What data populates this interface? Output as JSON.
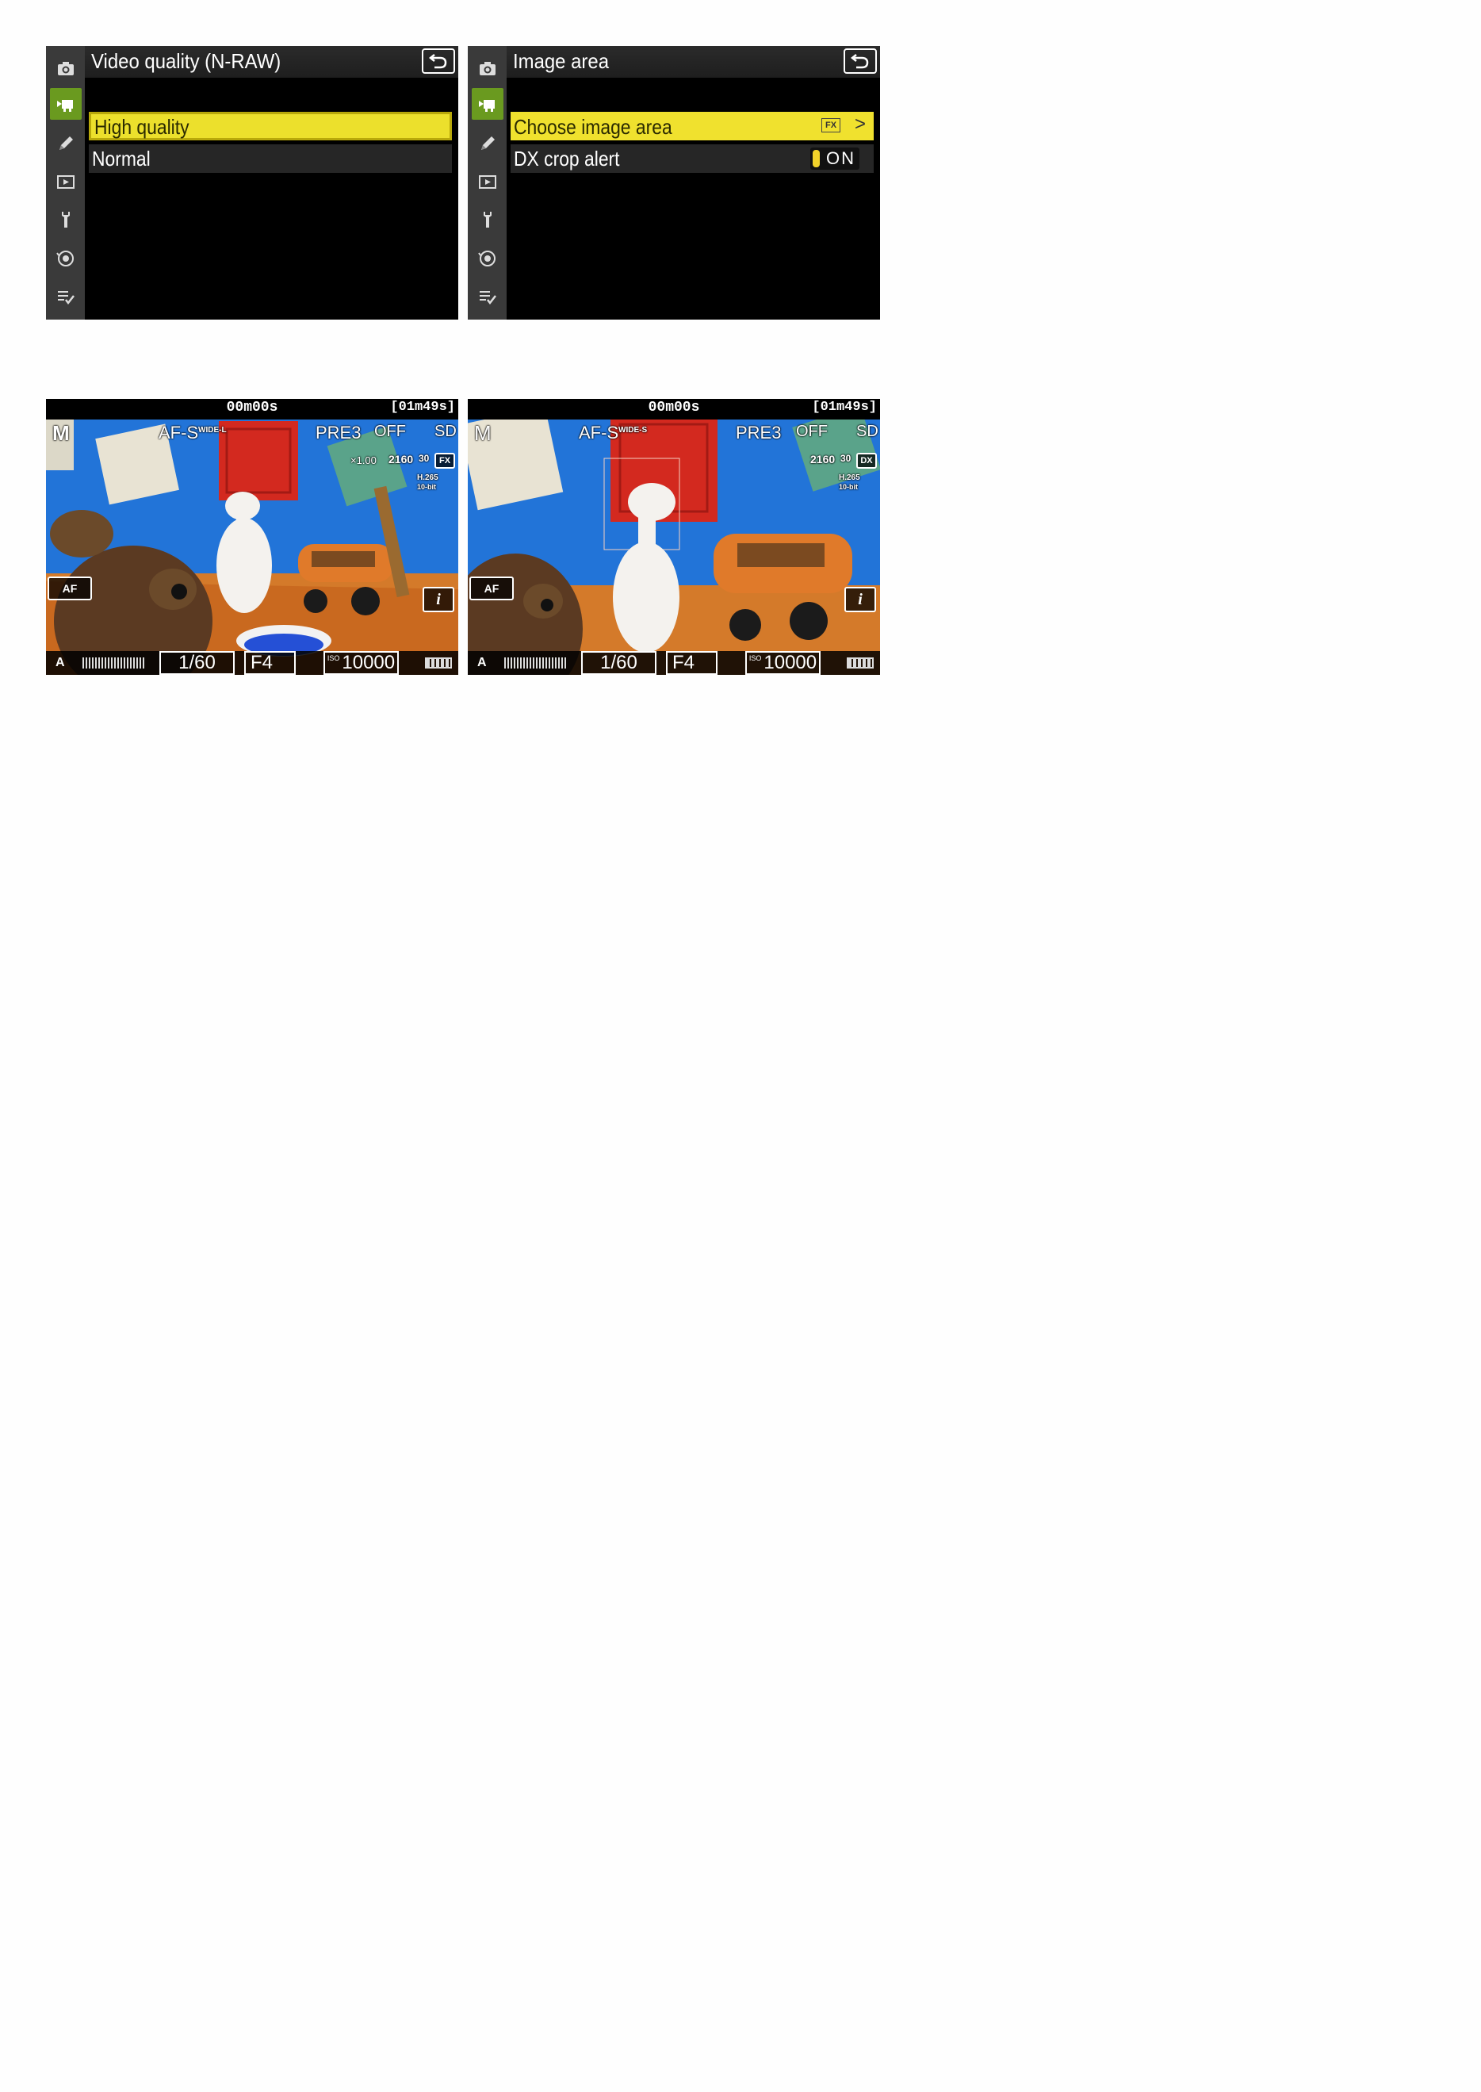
{
  "screens": {
    "video_quality": {
      "title": "Video quality (N-RAW)",
      "options": [
        "High quality",
        "Normal"
      ],
      "selected_index": 0
    },
    "image_area": {
      "title": "Image area",
      "options": [
        {
          "label": "Choose image area",
          "value_badge": "FX",
          "chevron": ">"
        },
        {
          "label": "DX crop alert",
          "toggle": "ON"
        }
      ],
      "selected_index": 0
    }
  },
  "sidebar_icons": [
    "camera-icon",
    "movie-icon",
    "pencil-icon",
    "playback-icon",
    "wrench-icon",
    "network-icon",
    "my-menu-icon"
  ],
  "liveview_fx": {
    "timer": "00m00s",
    "remaining": "[01m49s]",
    "mode": "M",
    "focus_mode": "AF-S",
    "af_area": "WIDE-L",
    "picture_control": "PRE3",
    "vr": "OFF",
    "card": "SD",
    "zoom": "×1.00",
    "frame_size": "2160",
    "frame_rate": "30",
    "image_area_badge": "FX",
    "codec": "H.265",
    "bit_depth": "10-bit",
    "af_badge": "AF",
    "info_badge": "i",
    "audio": "A",
    "shutter": "1/60",
    "aperture": "F4",
    "iso_label": "ISO",
    "iso": "10000"
  },
  "liveview_dx": {
    "timer": "00m00s",
    "remaining": "[01m49s]",
    "mode": "M",
    "focus_mode": "AF-S",
    "af_area": "WIDE-S",
    "picture_control": "PRE3",
    "vr": "OFF",
    "card": "SD",
    "frame_size": "2160",
    "frame_rate": "30",
    "image_area_badge": "DX",
    "codec": "H.265",
    "bit_depth": "10-bit",
    "af_badge": "AF",
    "info_badge": "i",
    "audio": "A",
    "shutter": "1/60",
    "aperture": "F4",
    "iso_label": "ISO",
    "iso": "10000"
  },
  "colors": {
    "highlight": "#ece02c",
    "active_tab": "#6a9a1f",
    "sky_blue": "#2a7be0"
  }
}
